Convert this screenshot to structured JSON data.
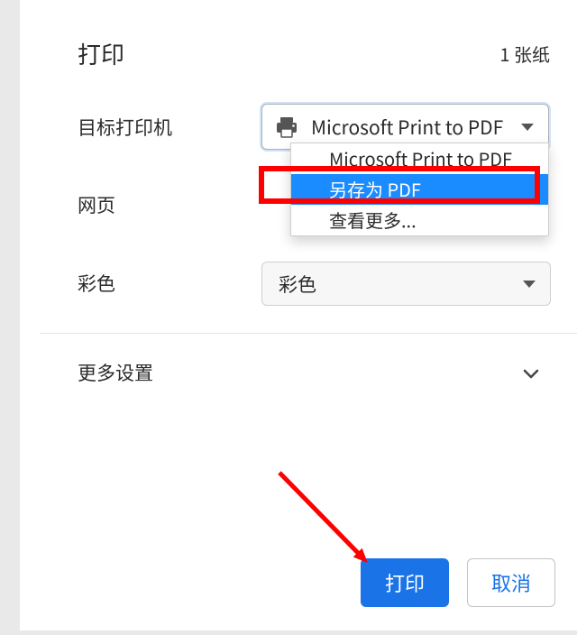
{
  "header": {
    "title": "打印",
    "page_count": "1 张纸"
  },
  "rows": {
    "destination_label": "目标打印机",
    "pages_label": "网页",
    "color_label": "彩色",
    "more_label": "更多设置"
  },
  "destination": {
    "selected": "Microsoft Print to PDF",
    "options": [
      "Microsoft Print to PDF",
      "另存为 PDF",
      "查看更多..."
    ],
    "highlight_index": 1
  },
  "color": {
    "selected": "彩色"
  },
  "buttons": {
    "primary": "打印",
    "secondary": "取消"
  },
  "colors": {
    "accent": "#1a74e8",
    "dropdown_highlight": "#1a8cff",
    "annotation": "#ff0000"
  }
}
